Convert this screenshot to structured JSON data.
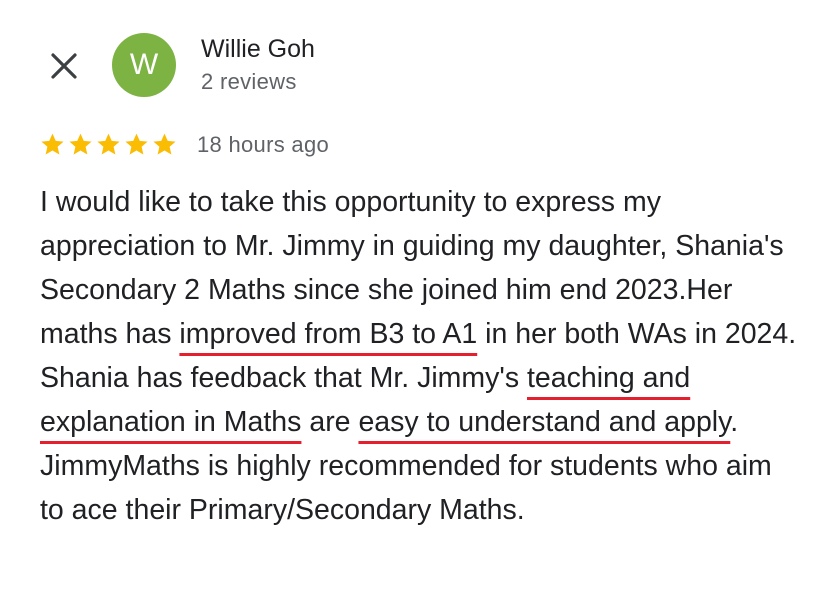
{
  "review": {
    "reviewer": {
      "initial": "W",
      "name": "Willie Goh",
      "review_count": "2 reviews",
      "avatar_color": "#7cb342"
    },
    "rating": 5,
    "star_color": "#fbbc04",
    "timestamp": "18 hours ago",
    "text_segments": [
      "I would like to take this opportunity to express my appreciation to Mr. Jimmy in guiding my daughter, Shania's Secondary 2 Maths since she joined him end 2023.Her maths has ",
      "improved from B3 to A1",
      " in her both WAs in 2024. Shania has feedback that Mr. Jimmy's ",
      "teaching and explanation in Maths",
      " are ",
      "easy to understand and apply",
      ". JimmyMaths is highly recommended for students who aim to ace their Primary/Secondary Maths."
    ],
    "highlight_color": "#e5202e"
  },
  "icons": {
    "close": "close-icon",
    "star": "star-icon"
  }
}
